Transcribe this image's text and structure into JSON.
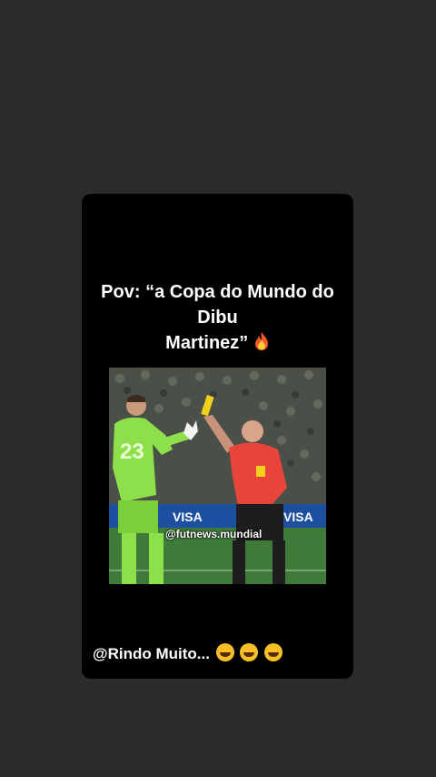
{
  "story": {
    "caption_line1": "Pov: “a Copa do Mundo do Dibu",
    "caption_line2": "Martinez”",
    "caption_emoji": "fire-icon",
    "video_watermark": "@futnews.mundial",
    "player_number": "23",
    "mention_text": "@Rindo Muito...",
    "mention_emojis": [
      "rolling-laughing-emoji",
      "rolling-laughing-emoji",
      "rolling-laughing-emoji"
    ],
    "ad_board_text": "VISA"
  },
  "colors": {
    "page_bg": "#2b2b2b",
    "card_bg": "#000000",
    "text": "#ffffff",
    "keeper_kit": "#8ee04a",
    "referee_shirt": "#e8453a",
    "card_yellow": "#f1d11c"
  }
}
